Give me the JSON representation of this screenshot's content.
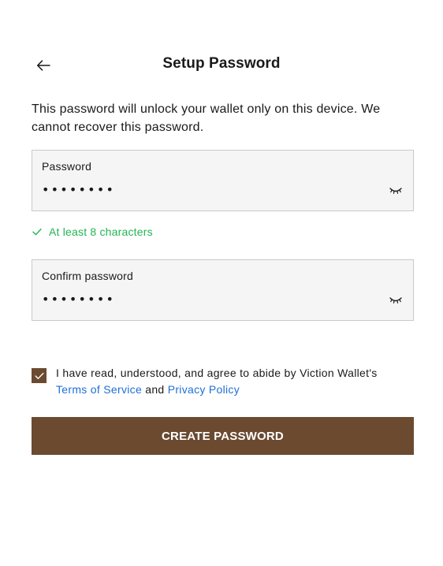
{
  "header": {
    "title": "Setup Password",
    "back_icon": "arrow-left-icon"
  },
  "description": "This password will unlock your wallet only on this device. We cannot recover this password.",
  "password_field": {
    "label": "Password",
    "value": "••••••••",
    "toggle_icon": "eye-closed-icon"
  },
  "hint": {
    "text": "At least 8 characters",
    "icon": "check-icon",
    "color": "#22b455"
  },
  "confirm_field": {
    "label": "Confirm password",
    "value": "••••••••",
    "toggle_icon": "eye-closed-icon"
  },
  "agreement": {
    "checked": true,
    "text_before": "I have read, understood, and agree to abide by Viction Wallet's ",
    "terms_link": "Terms of Service",
    "text_between": " and ",
    "privacy_link": "Privacy Policy"
  },
  "create_button": {
    "label": "CREATE PASSWORD"
  },
  "colors": {
    "accent": "#6b4a30",
    "link": "#1f6fd6",
    "success": "#22b455"
  }
}
